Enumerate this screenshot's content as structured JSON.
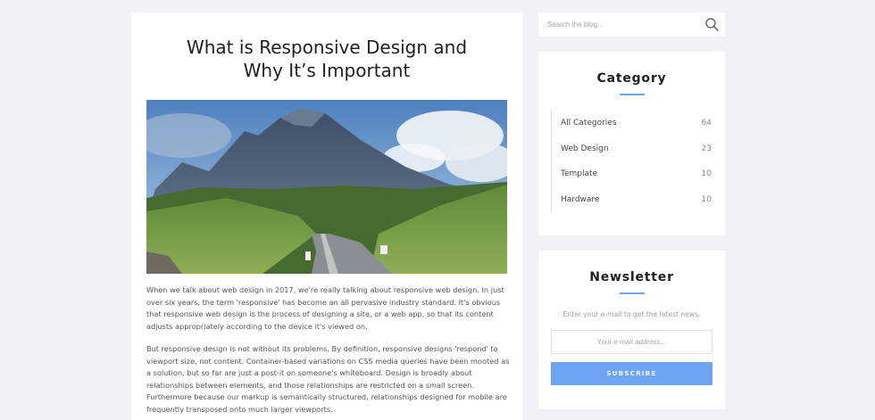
{
  "post": {
    "title_line1": "What is Responsive Design and",
    "title_line2": "Why It’s Important",
    "image_subject": "mountain road landscape",
    "paragraph1": "When we talk about web design in 2017, we're really talking about responsive web design. In just over six years, the term 'responsive' has become an all pervasive industry standard. It's obvious that responsive web design is the process of designing a site, or a web app, so that its content adjusts appropriately according to the device it's viewed on.",
    "paragraph2": "But responsive design is not without its problems. By definition, responsive designs 'respond' to viewport size, not content. Container-based variations on CSS media queries have been mooted as a solution, but so far are just a post-it on someone's whiteboard. Design is broadly about relationships between elements, and those relationships are restricted on a small screen. Furthermore because our markup is semantically structured, relationships designed for mobile are frequently transposed onto much larger viewports."
  },
  "search": {
    "placeholder": "Search the blog...",
    "icon": "search-icon"
  },
  "category": {
    "title": "Category",
    "items": [
      {
        "label": "All Categories",
        "count": "64"
      },
      {
        "label": "Web Design",
        "count": "23"
      },
      {
        "label": "Template",
        "count": "10"
      },
      {
        "label": "Hardware",
        "count": "10"
      }
    ]
  },
  "newsletter": {
    "title": "Newsletter",
    "text": "Enter your e-mail to get the latest news.",
    "input_placeholder": "Your e-mail address...",
    "button_label": "SUBSCRIBE"
  },
  "colors": {
    "page_background": "#f1f2f6",
    "accent": "#6ea4f2",
    "card": "#ffffff"
  }
}
